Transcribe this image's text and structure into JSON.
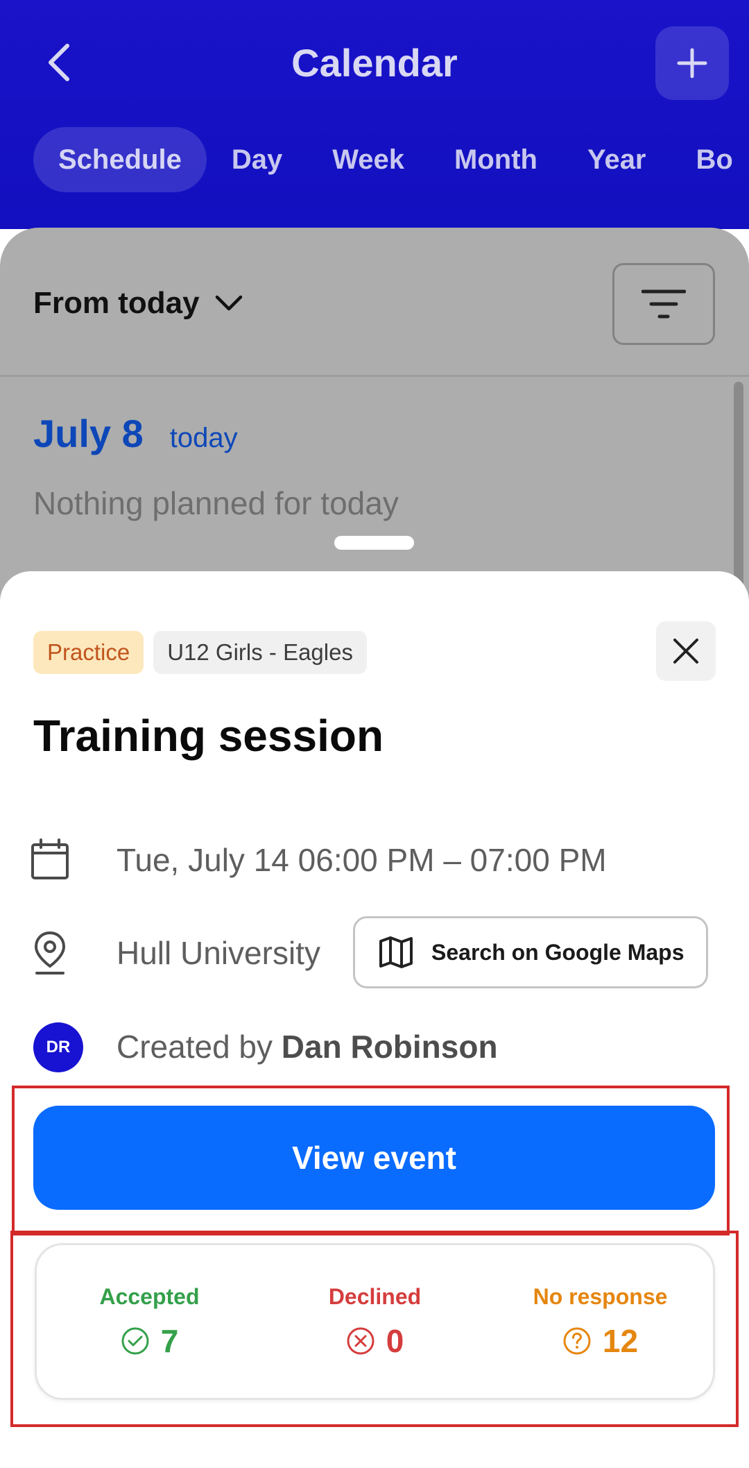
{
  "header": {
    "title": "Calendar",
    "tabs": [
      {
        "label": "Schedule",
        "active": true
      },
      {
        "label": "Day"
      },
      {
        "label": "Week"
      },
      {
        "label": "Month"
      },
      {
        "label": "Year"
      },
      {
        "label": "Bo"
      }
    ]
  },
  "filter": {
    "range_label": "From today"
  },
  "agenda": {
    "date": "July 8",
    "date_tag": "today",
    "empty_text": "Nothing planned for today"
  },
  "event": {
    "type_chip": "Practice",
    "team_chip": "U12 Girls - Eagles",
    "title": "Training session",
    "datetime": "Tue, July 14 06:00 PM – 07:00 PM",
    "location": "Hull University",
    "maps_button": "Search on Google Maps",
    "created_prefix": "Created by",
    "creator_name": "Dan Robinson",
    "creator_initials": "DR",
    "view_button": "View event"
  },
  "rsvp": {
    "accepted_label": "Accepted",
    "accepted_count": "7",
    "declined_label": "Declined",
    "declined_count": "0",
    "no_response_label": "No response",
    "no_response_count": "12"
  },
  "colors": {
    "header_bg": "#1a13c9",
    "primary_button": "#0a6bff",
    "accepted": "#34a04a",
    "declined": "#d53d3d",
    "no_response": "#e5860f",
    "highlight": "#d42a2a"
  }
}
